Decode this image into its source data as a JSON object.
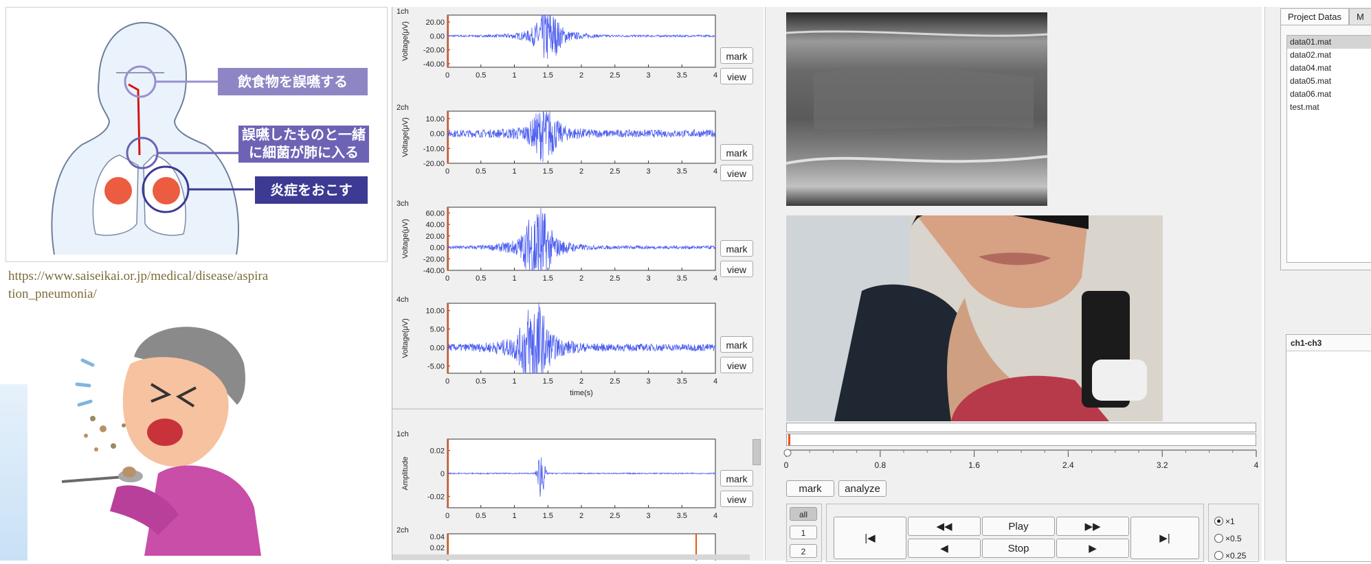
{
  "illustration": {
    "labels": [
      "飲食物を誤嚥する",
      "誤嚥したものと一緒",
      "に細菌が肺に入る",
      "炎症をおこす"
    ],
    "source_url_line1": "https://www.saiseikai.or.jp/medical/disease/aspira",
    "source_url_line2": "tion_pneumonia/"
  },
  "plots": {
    "ylabel_voltage": "Voltage(μV)",
    "ylabel_amplitude": "Amplitude",
    "xlabel": "time(s)",
    "mark_label": "mark",
    "view_label": "view",
    "channels": [
      {
        "name": "1ch",
        "ticks": [
          "20.00",
          "0.00",
          "-20.00",
          "-40.00"
        ],
        "ylim": [
          -45,
          30
        ]
      },
      {
        "name": "2ch",
        "ticks": [
          "10.00",
          "0.00",
          "-10.00",
          "-20.00"
        ],
        "ylim": [
          -20,
          15
        ]
      },
      {
        "name": "3ch",
        "ticks": [
          "60.00",
          "40.00",
          "20.00",
          "0.00",
          "-20.00",
          "-40.00"
        ],
        "ylim": [
          -40,
          70
        ]
      },
      {
        "name": "4ch",
        "ticks": [
          "10.00",
          "5.00",
          "0.00",
          "-5.00"
        ],
        "ylim": [
          -7,
          12
        ]
      }
    ],
    "xticks": [
      "0",
      "0.5",
      "1",
      "1.5",
      "2",
      "2.5",
      "3",
      "3.5",
      "4"
    ],
    "amp_channels": [
      {
        "name": "1ch",
        "ticks": [
          "0.02",
          "0",
          "-0.02"
        ]
      },
      {
        "name": "2ch",
        "ticks": [
          "0.04",
          "0.02"
        ]
      }
    ]
  },
  "chart_data": {
    "type": "line",
    "x": [
      0,
      4
    ],
    "xlabel": "time(s)",
    "series": [
      {
        "name": "1ch",
        "xlim": [
          0,
          4
        ],
        "ylim": [
          -45,
          30
        ],
        "burst_center": 1.5,
        "peak": 32,
        "base_noise": 1.5
      },
      {
        "name": "2ch",
        "xlim": [
          0,
          4
        ],
        "ylim": [
          -20,
          15
        ],
        "burst_center": 1.45,
        "peak": 14,
        "base_noise": 2.5
      },
      {
        "name": "3ch",
        "xlim": [
          0,
          4
        ],
        "ylim": [
          -40,
          70
        ],
        "burst_center": 1.35,
        "peak": 65,
        "base_noise": 3
      },
      {
        "name": "4ch",
        "xlim": [
          0,
          4
        ],
        "ylim": [
          -7,
          12
        ],
        "burst_center": 1.3,
        "peak": 11,
        "base_noise": 1
      },
      {
        "name": "1ch amplitude",
        "xlim": [
          0,
          4
        ],
        "ylim": [
          -0.03,
          0.03
        ],
        "burst_center": 1.4,
        "peak": 0.025,
        "base_noise": 0.0005
      }
    ]
  },
  "player": {
    "timeline_ticks": [
      "0",
      "0.8",
      "1.6",
      "2.4",
      "3.2",
      "4"
    ],
    "mark_label": "mark",
    "analyze_label": "analyze",
    "play_label": "Play",
    "stop_label": "Stop",
    "rewind_label": "◀◀",
    "forward_label": "▶▶",
    "step_back_label": "◀",
    "step_forward_label": "▶",
    "start_label": "|◀",
    "end_label": "▶|",
    "channel_buttons": [
      "all",
      "1",
      "2"
    ],
    "speeds": [
      "×1",
      "×0.5",
      "×0.25"
    ],
    "selected_speed": "×1"
  },
  "sidebar": {
    "tabs": [
      "Project Datas",
      "M"
    ],
    "files": [
      "data01.mat",
      "data02.mat",
      "data04.mat",
      "data05.mat",
      "data06.mat",
      "test.mat"
    ],
    "selected_file": "data01.mat",
    "channel_group": "ch1-ch3"
  },
  "colors": {
    "signal": "#4d5ff0",
    "marker": "#e8551b",
    "label_light": "#8e86c4",
    "label_mid": "#6d63b4",
    "label_dark": "#3c3a92"
  }
}
